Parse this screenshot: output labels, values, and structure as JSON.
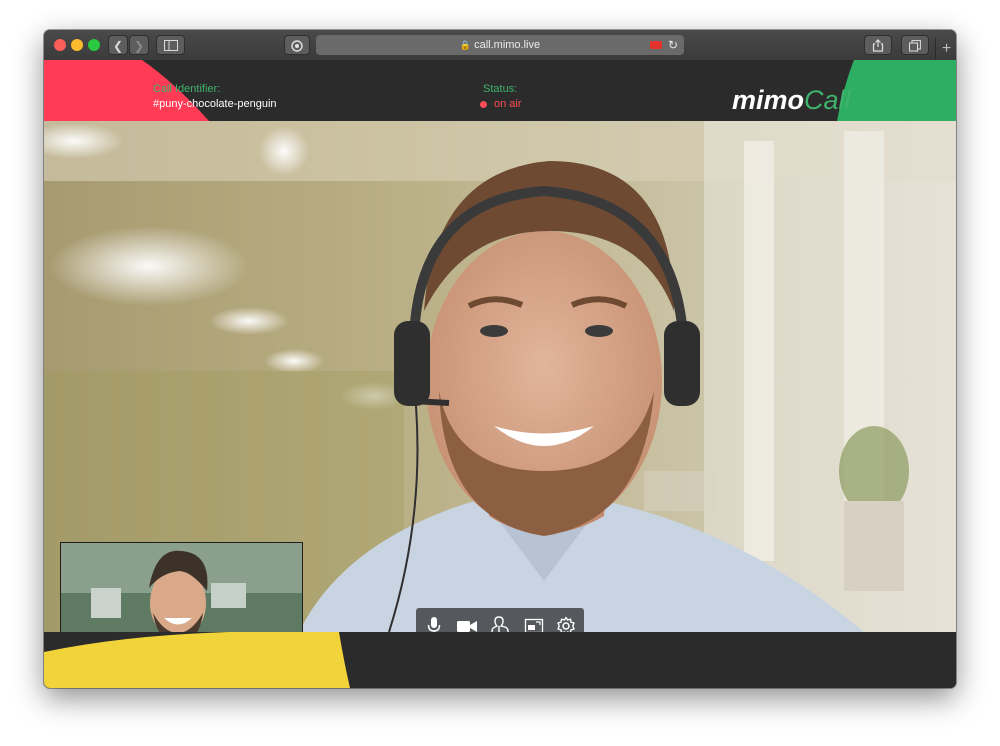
{
  "browser": {
    "url": "call.mimo.live",
    "buttons": {
      "back": "back",
      "forward": "forward",
      "sidebar": "sidebar",
      "privacy": "privacy-report",
      "share": "share",
      "tabs": "tab-overview",
      "new_tab": "+"
    }
  },
  "header": {
    "call_identifier_label": "Call Identifier:",
    "call_identifier_value": "#puny-chocolate-penguin",
    "status_label": "Status:",
    "status_value": "on air",
    "logo_part1": "mimo",
    "logo_part2": "Call"
  },
  "controls": [
    {
      "icon": "microphone-icon"
    },
    {
      "icon": "camera-icon"
    },
    {
      "icon": "person-icon"
    },
    {
      "icon": "picture-in-picture-icon"
    },
    {
      "icon": "gear-icon"
    }
  ],
  "colors": {
    "accent_red": "#ff3b55",
    "accent_green": "#2eae62",
    "accent_yellow": "#f0d43a",
    "bar_background": "#2b2b2b"
  }
}
